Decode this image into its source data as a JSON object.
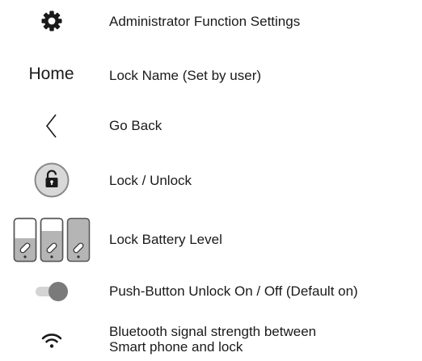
{
  "legend": {
    "rows": [
      {
        "icon": "gear-icon",
        "description": "Administrator Function Settings"
      },
      {
        "icon": "home-text-label",
        "icon_text": "Home",
        "description": "Lock Name (Set by user)"
      },
      {
        "icon": "chevron-left-icon",
        "description": "Go Back"
      },
      {
        "icon": "padlock-icon",
        "description": "Lock / Unlock"
      },
      {
        "icon": "battery-level-icons",
        "description": "Lock Battery Level"
      },
      {
        "icon": "toggle-switch-icon",
        "description": "Push-Button Unlock On / Off (Default on)"
      },
      {
        "icon": "wifi-signal-icon",
        "description": "Bluetooth signal strength between",
        "description_line2": "Smart phone and lock"
      }
    ]
  },
  "colors": {
    "icon_dark": "#1a1a1a",
    "icon_gray": "#8a8a8a",
    "icon_light_gray": "#d8d8d8",
    "battery_fill": "#b5b5b5",
    "toggle_track": "#d4d4d4",
    "toggle_knob": "#7a7a7a"
  }
}
